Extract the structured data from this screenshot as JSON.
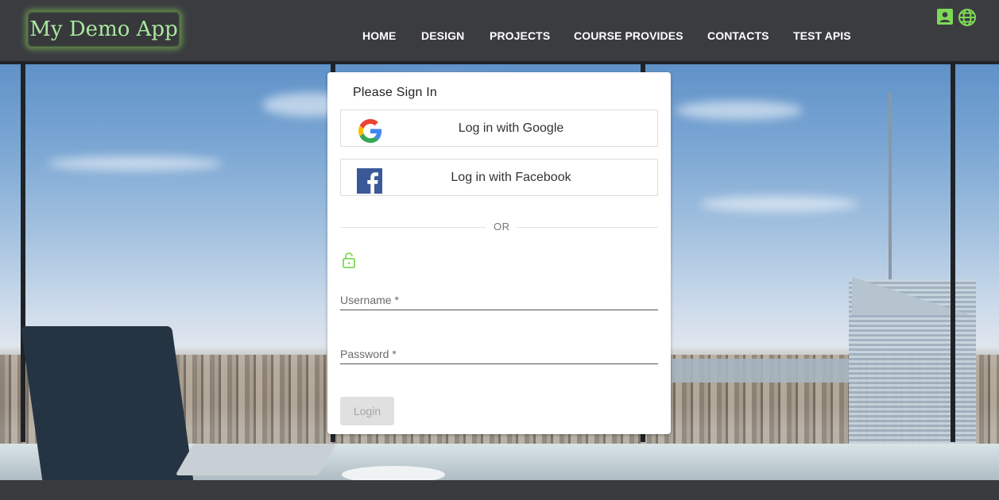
{
  "app": {
    "logo_text": "My Demo App"
  },
  "nav": {
    "items": [
      {
        "label": "HOME"
      },
      {
        "label": "DESIGN"
      },
      {
        "label": "PROJECTS"
      },
      {
        "label": "COURSE PROVIDES"
      },
      {
        "label": "CONTACTS"
      },
      {
        "label": "TEST APIS"
      }
    ]
  },
  "header_icons": [
    "account-box-icon",
    "globe-icon"
  ],
  "signin": {
    "title": "Please Sign In",
    "google_label": "Log in with Google",
    "facebook_label": "Log in with Facebook",
    "or_text": "OR",
    "username_label": "Username *",
    "password_label": "Password *",
    "username_value": "",
    "password_value": "",
    "login_label": "Login"
  },
  "colors": {
    "accent_green": "#7ed957",
    "header_bg": "#3b3c40",
    "logo_text": "#a9e8a0",
    "facebook_blue": "#3b5998",
    "login_disabled_bg": "#e0e0e0"
  }
}
